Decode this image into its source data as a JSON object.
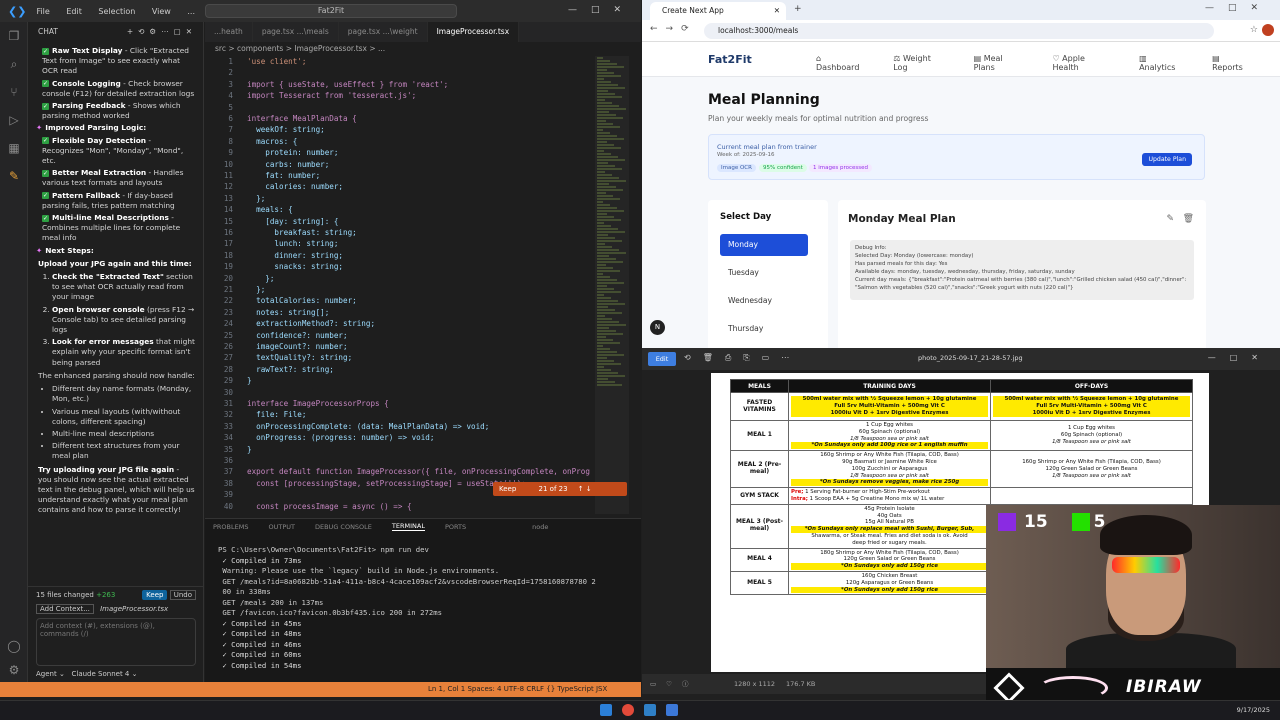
{
  "vscode": {
    "menu": [
      "File",
      "Edit",
      "Selection",
      "View",
      "..."
    ],
    "search": "Fat2Fit",
    "chat_title": "CHAT",
    "chat_items": [
      {
        "type": "check",
        "bold": "Raw Text Display",
        "text": " - Click \"Extracted Text from Image\" to see exactly what OCR read"
      },
      {
        "type": "check",
        "bold": "Console Logging",
        "text": " - Check browser console (F12) for detailed extraction logs"
      },
      {
        "type": "check",
        "bold": "Parsing Feedback",
        "text": " - Shows which parsing method worked"
      },
      {
        "type": "head",
        "bold": "Improved Parsing Logic:",
        "text": ""
      },
      {
        "type": "check",
        "bold": "Flexible Day Detection",
        "text": " - Recognizes \"Mon\", \"Monday\", \"Mond\", etc."
      },
      {
        "type": "check",
        "bold": "Better Meal Extraction",
        "text": " - Handles various text formats and layouts"
      },
      {
        "type": "check",
        "bold": "Pattern Fallback",
        "text": " - If day-based parsing fails, tries pattern matching"
      },
      {
        "type": "check",
        "bold": "Multi-line Meal Descriptions",
        "text": " - Combines multiple lines for complete meal info"
      },
      {
        "type": "head",
        "bold": "Next Steps:",
        "text": ""
      }
    ],
    "upload_line": "Upload your JPG again and this time:",
    "steps": [
      {
        "bold": "Check the \"Extracted Text\"",
        "text": " section to see what OCR actually read from your image"
      },
      {
        "bold": "Open browser console",
        "text": " (press F12 → Console tab) to see detailed parsing logs"
      },
      {
        "bold": "Look for error messages",
        "text": " that might explain why your specific format isn't being parsed"
      }
    ],
    "handle_line": "The enhanced parsing should now handle:",
    "bullets": [
      "Different day name formats (Monday, Mon, etc.)",
      "Various meal layouts (with/without colons, different spacing)",
      "Multi-line meal descriptions",
      "Different text structures from your meal plan"
    ],
    "closing_bold": "Try uploading your JPG file again",
    "closing": " - you should now see the actual extracted text in the debug panel, which will help us understand exactly what your meal plan contains and how to parse it correctly!",
    "files_changed": "15 files changed",
    "files_changed_count": "+263",
    "keep": "Keep",
    "undo": "Undo",
    "add_context": "Add Context...",
    "context_file": "ImageProcessor.tsx",
    "input_placeholder": "Add context (#), extensions (@), commands (/)",
    "agent": "Agent",
    "model": "Claude Sonnet 4",
    "tabs": [
      "...heath",
      "page.tsx ...\\meals",
      "page.tsx ...\\weight",
      "ImageProcessor.tsx"
    ],
    "breadcrumb": "src > components > ImageProcessor.tsx > ...",
    "code_lines": [
      "'use client';",
      "",
      "import { useState, useEffect } from 'react';",
      "import Tesseract from 'tesseract.js';",
      "",
      "interface MealPlanData {",
      "  weekOf: string;",
      "  macros: {",
      "    protein: number;",
      "    carbs: number;",
      "    fat: number;",
      "    calories: number;",
      "  };",
      "  meals: {",
      "    [day: string]: {",
      "      breakfast: string;",
      "      lunch: string;",
      "      dinner: string;",
      "      snacks: string;",
      "    };",
      "  };",
      "  totalCalories: number;",
      "  notes: string[];",
      "  extractionMethod?: string;",
      "  confidence?: number;",
      "  imageCount?: number;",
      "  textQuality?: string;",
      "  rawText?: string;",
      "}",
      "",
      "interface ImageProcessorProps {",
      "  file: File;",
      "  onProcessingComplete: (data: MealPlanData) => void;",
      "  onProgress: (progress: number) => void;",
      "}",
      "",
      "export default function ImageProcessor({ file, onProcessingComplete, onProg",
      "  const [processingStage, setProcessingStage] = useState('');",
      "",
      "  const processImage = async () => {"
    ],
    "inline_keep": "Keep",
    "inline_count": "21 of 23",
    "terminal_tabs": [
      "PROBLEMS",
      "OUTPUT",
      "DEBUG CONSOLE",
      "TERMINAL",
      "PORTS"
    ],
    "terminal_node": "node",
    "terminal_lines": [
      "PS C:\\Users\\Owner\\Documents\\Fat2Fit> npm run dev",
      " ✓ Compiled in 73ms",
      " Warning: Please use the `legacy` build in Node.js environments.",
      " GET /meals?id=8a0682bb-51a4-411a-b8c4-4cace109acf2&vscodeBrowserReqId=1758160878780 2",
      " 00 in 338ms",
      " GET /meals 200 in 137ms",
      " GET /favicon.ico?favicon.0b3bf435.ico 200 in 272ms",
      " ✓ Compiled in 45ms",
      " ✓ Compiled in 48ms",
      " ✓ Compiled in 46ms",
      " ✓ Compiled in 60ms",
      " ✓ Compiled in 54ms"
    ],
    "status": "Ln 1, Col 1   Spaces: 4   UTF-8   CRLF   {} TypeScript JSX"
  },
  "chrome": {
    "tab_title": "Create Next App",
    "url": "localhost:3000/meals"
  },
  "app": {
    "brand": "Fat2Fit",
    "nav": [
      "Dashboard",
      "Weight Log",
      "Meal Plans",
      "Apple Health",
      "Analytics",
      "Reports"
    ],
    "title": "Meal Planning",
    "subtitle": "Plan your weekly meals for optimal nutrition and progress",
    "trainer_title": "Current meal plan from trainer",
    "trainer_week": "Week of: 2025-09-16",
    "badges": [
      "Image OCR",
      "95% confident",
      "1 images processed"
    ],
    "update_button": "Update Plan",
    "select_day": "Select Day",
    "days": [
      "Monday",
      "Tuesday",
      "Wednesday",
      "Thursday"
    ],
    "plan_title": "Monday Meal Plan",
    "debug_lines": [
      "Debug Info:",
      "Selected Day: Monday (lowercase: monday)",
      "Has parsed meals for this day: Yes",
      "Available days: monday, tuesday, wednesday, thursday, friday, saturday, sunday",
      "Current day meals: {\"breakfast\":\"Protein oatmeal with berries (380 cal)\",\"lunch\":\"Grilled chicken salad (450 cal)\",\"dinner\":",
      "\"Salmon with vegetables (520 cal)\",\"snacks\":\"Greek yogurt with nuts (220 cal)\"}"
    ],
    "n_badge": "N"
  },
  "viewer": {
    "edit": "Edit",
    "filename": "photo_2025-09-17_21-28-57.jpg",
    "dims": "1280 x 1112",
    "size": "176.7 KB",
    "headers": [
      "MEALS",
      "TRAINING DAYS",
      "OFF-DAYS"
    ],
    "rows": [
      {
        "label": "FASTED VITAMINS",
        "train": [
          "500ml water mix with ½ Squeeze lemon + 10g glutamine",
          "Full 5rv Multi-Vitamin + 500mg Vit C",
          "1000iu Vit D + 1srv Digestive Enzymes"
        ],
        "off": [
          "500ml water mix with ½ Squeeze lemon + 10g glutamine",
          "Full 5rv Multi-Vitamin + 500mg Vit C",
          "1000iu Vit D + 1srv Digestive Enzymes"
        ]
      },
      {
        "label": "MEAL 1",
        "train": [
          "1 Cup Egg whites",
          "60g Spinach (optional)",
          "1/8 Teaspoon sea or pink salt",
          "*On Sundays only add 100g rice or 1 english muffin"
        ],
        "off": [
          "1 Cup Egg whites",
          "60g Spinach (optional)",
          "1/8 Teaspoon sea or pink salt"
        ]
      },
      {
        "label": "MEAL 2 (Pre-meal)",
        "train": [
          "160g Shrimp or Any White Fish (Tilapia, COD, Bass)",
          "90g Basmati or Jasmine White Rice",
          "100g Zucchini or Asparagus",
          "1/8 Teaspoon sea or pink salt",
          "*On Sundays remove veggies, make rice 250g"
        ],
        "off": [
          "160g Shrimp or Any White Fish (Tilapia, COD, Bass)",
          "120g Green Salad or Green Beans",
          "1/8 Teaspoon sea or pink salt"
        ]
      },
      {
        "label": "GYM STACK",
        "train": [
          "Pre; 1 Serving Fat-burner or High-Stim Pre-workout",
          "Intra; 1 Scoop EAA + 5g Creatine Mono mix w/ 1L water"
        ],
        "off": []
      },
      {
        "label": "MEAL 3 (Post-meal)",
        "train": [
          "45g Protein Isolate",
          "40g Oats",
          "15g All Natural PB",
          "*On Sundays only replace meal with Sushi, Burger, Sub,",
          "Shawarma, or Steak meal. Fries and diet soda is ok. Avoid",
          "deep fried or sugary meals."
        ],
        "off": []
      },
      {
        "label": "MEAL 4",
        "train": [
          "180g Shrimp or Any White Fish (Tilapia, COD, Bass)",
          "120g Green Salad or Green Beans",
          "*On Sundays only add 150g rice"
        ],
        "off": []
      },
      {
        "label": "MEAL 5",
        "train": [
          "160g Chicken Breast",
          "120g Asparagus or Green Beans",
          "*On Sundays only add 150g rice"
        ],
        "off": []
      }
    ]
  },
  "stream": {
    "stat1": "15",
    "stat2": "5",
    "brand": "IBIRAW"
  },
  "taskbar": {
    "time": "9/17/2025"
  },
  "colors": {
    "accent_blue": "#1d4ed8",
    "status_orange": "#e7813a",
    "highlight_yellow": "#ffea00"
  }
}
